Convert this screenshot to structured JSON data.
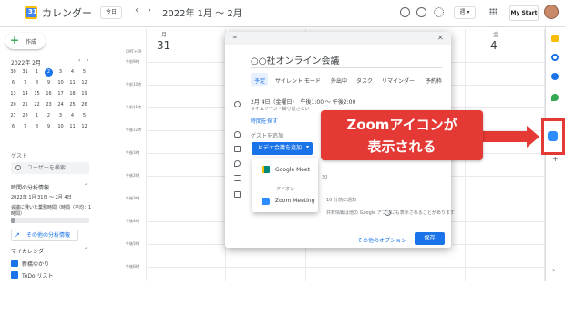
{
  "header": {
    "logo_text": "31",
    "app_title": "カレンダー",
    "today_label": "今日",
    "prev_arrow": "‹",
    "next_arrow": "›",
    "date_range": "2022年 1月 〜 2月",
    "view_label": "週 ▾",
    "brand_label": "My Start"
  },
  "sidebar": {
    "create_label": "作成",
    "mini_calendar": {
      "title": "2022年 2月",
      "prev": "‹",
      "next": "›",
      "weekdays": [
        "日",
        "月",
        "火",
        "水",
        "木",
        "金",
        "土"
      ],
      "days": [
        "30",
        "31",
        "1",
        "2",
        "3",
        "4",
        "5",
        "6",
        "7",
        "8",
        "9",
        "10",
        "11",
        "12",
        "13",
        "14",
        "15",
        "16",
        "17",
        "18",
        "19",
        "20",
        "21",
        "22",
        "23",
        "24",
        "25",
        "26",
        "27",
        "28",
        "1",
        "2",
        "3",
        "4",
        "5",
        "6",
        "7",
        "8",
        "9",
        "10",
        "11",
        "12"
      ],
      "selected_day": "2"
    },
    "guest_label": "ゲスト",
    "user_search_placeholder": "ユーザーを検索",
    "stats": {
      "title": "時間の分析情報",
      "date_range": "2022年 1月 31日 〜 2月 4日",
      "description": "会議に費いた業務時間（時間（平均：1",
      "description2": "時間）",
      "more_label": "その他の分析情報",
      "progress": 0.05
    },
    "my_calendars_title": "マイカレンダー",
    "calendars": [
      "新橋ゆかり",
      "ToDo リスト"
    ]
  },
  "grid": {
    "columns": [
      {
        "day": "月",
        "date": "31"
      },
      {
        "day": "",
        "date": ""
      },
      {
        "day": "",
        "date": ""
      },
      {
        "day": "",
        "date": ""
      },
      {
        "day": "金",
        "date": "4"
      }
    ],
    "timezone": "GMT+09",
    "times": [
      "午前9時",
      "午前10時",
      "午前11時",
      "午後12時",
      "午後1時",
      "午後2時",
      "午後3時",
      "午後4時",
      "午後5時",
      "午後6時"
    ]
  },
  "dialog": {
    "title": "○○社オンライン会議",
    "tabs": [
      "予定",
      "サイレント モード",
      "外出中",
      "タスク",
      "リマインダー",
      "予約枠"
    ],
    "date_time": "2月 4日（金曜日）　午後1:00 〜 午後2:00",
    "timezone_note": "タイムゾーン・繰り返さない",
    "find_time": "時間を探す",
    "add_guest": "ゲストを追加",
    "video_button": "ビデオ会議を追加",
    "dropdown": {
      "google_meet": "Google Meet",
      "addon_label": "アドオン",
      "zoom_meeting": "Zoom Meeting"
    },
    "partial_30": "30",
    "notify_note": "・10 分前に通知",
    "footer_note": "・共有情報は他の Google アプリにも表示されることがあります",
    "more_options": "その他のオプション",
    "save_label": "保存"
  },
  "callout": {
    "line1": "Zoomアイコンが",
    "line2": "表示される"
  },
  "colors": {
    "accent": "#1a73e8",
    "callout_red": "#e53935",
    "zoom_blue": "#2d8cff"
  }
}
